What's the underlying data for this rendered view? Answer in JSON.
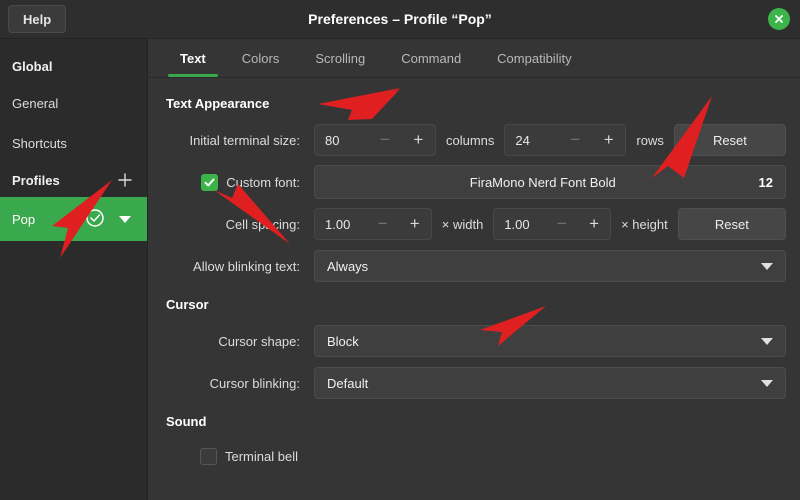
{
  "window": {
    "title": "Preferences – Profile “Pop”",
    "help_label": "Help",
    "close_icon": "close-icon"
  },
  "sidebar": {
    "global_header": "Global",
    "items": [
      {
        "label": "General"
      },
      {
        "label": "Shortcuts"
      }
    ],
    "profiles_header": "Profiles",
    "add_profile_icon": "plus-icon",
    "profiles": [
      {
        "label": "Pop",
        "selected": true,
        "check_icon": "circle-check-icon",
        "menu_icon": "chevron-down-icon"
      }
    ]
  },
  "tabs": [
    {
      "label": "Text",
      "active": true
    },
    {
      "label": "Colors",
      "active": false
    },
    {
      "label": "Scrolling",
      "active": false
    },
    {
      "label": "Command",
      "active": false
    },
    {
      "label": "Compatibility",
      "active": false
    }
  ],
  "text_appearance": {
    "section_title": "Text Appearance",
    "terminal_size": {
      "label": "Initial terminal size:",
      "columns_value": "80",
      "columns_unit": "columns",
      "rows_value": "24",
      "rows_unit": "rows",
      "reset_label": "Reset",
      "minus_icon": "minus-icon",
      "plus_icon": "plus-icon"
    },
    "custom_font": {
      "label": "Custom font:",
      "checked": true,
      "font_name": "FiraMono Nerd Font Bold",
      "font_size": "12"
    },
    "cell_spacing": {
      "label": "Cell spacing:",
      "width_value": "1.00",
      "width_unit": "× width",
      "height_value": "1.00",
      "height_unit": "× height",
      "reset_label": "Reset"
    },
    "blinking_text": {
      "label": "Allow blinking text:",
      "value": "Always"
    }
  },
  "cursor": {
    "section_title": "Cursor",
    "shape": {
      "label": "Cursor shape:",
      "value": "Block"
    },
    "blinking": {
      "label": "Cursor blinking:",
      "value": "Default"
    }
  },
  "sound": {
    "section_title": "Sound",
    "terminal_bell": {
      "label": "Terminal bell",
      "checked": false
    }
  },
  "colors": {
    "accent_green": "#3aa84c",
    "checkbox_green": "#3cb44a",
    "annotation_red": "#e02020",
    "window_bg": "#353535",
    "sidebar_bg": "#2b2b2b",
    "titlebar_bg": "#2e2e2e"
  }
}
